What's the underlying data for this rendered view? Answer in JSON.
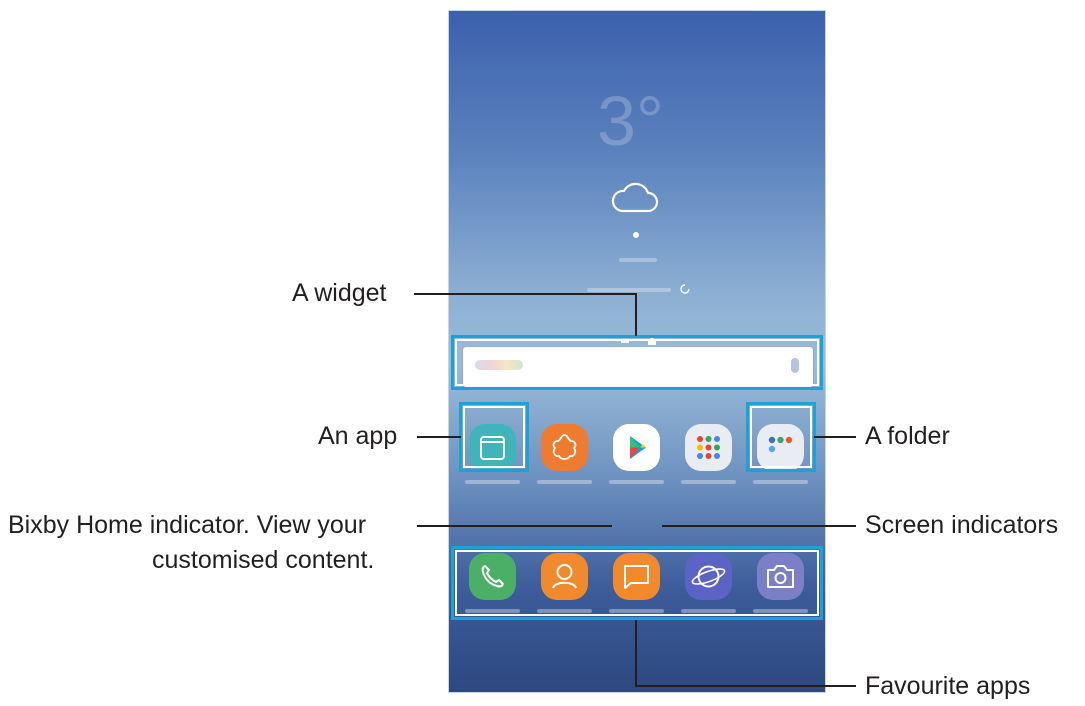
{
  "callouts": {
    "widget": "A widget",
    "app": "An app",
    "bixby_line1": "Bixby Home indicator. View your",
    "bixby_line2": "customised content.",
    "folder": "A folder",
    "screen_indicators": "Screen indicators",
    "favourite_apps": "Favourite apps"
  },
  "phone": {
    "weather": {
      "temperature": "3°",
      "icon": "cloud-icon"
    },
    "search_widget": {
      "icon_left": "google-logo",
      "icon_right": "mic-icon"
    },
    "app_row": [
      "calendar-icon",
      "gallery-icon",
      "play-store-icon",
      "google-folder-icon",
      "samsung-folder-icon"
    ],
    "dock": [
      "phone-icon",
      "contacts-icon",
      "messages-icon",
      "internet-icon",
      "camera-icon"
    ]
  },
  "colors": {
    "highlight": "#19a3d9",
    "text": "#231f20",
    "phone_green": "#4caf67",
    "orange": "#f08a2c",
    "internet_purple": "#5b63c5"
  }
}
